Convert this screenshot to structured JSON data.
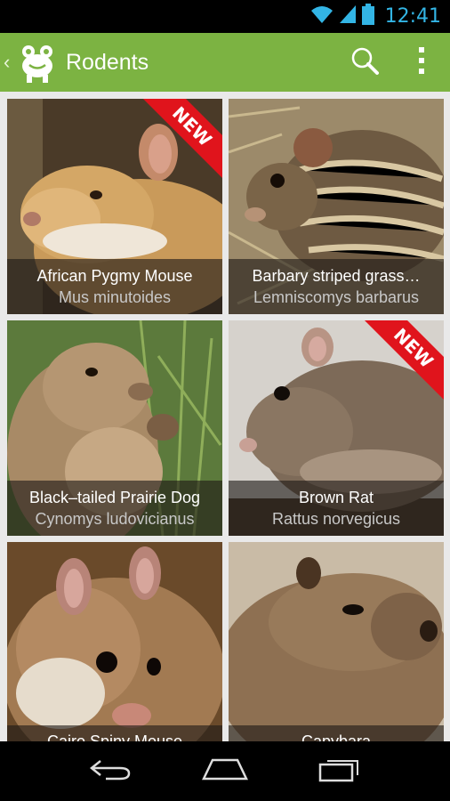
{
  "status_bar": {
    "time": "12:41",
    "icons": [
      "wifi-icon",
      "signal-icon",
      "battery-icon"
    ],
    "time_color": "#33b5e5"
  },
  "action_bar": {
    "title": "Rodents",
    "background": "#7cb342",
    "actions": [
      "search-icon",
      "overflow-menu-icon"
    ]
  },
  "grid": {
    "items": [
      {
        "common_name": "African Pygmy Mouse",
        "scientific_name": "Mus minutoides",
        "is_new": true,
        "badge": "NEW"
      },
      {
        "common_name": "Barbary striped grass…",
        "scientific_name": "Lemniscomys barbarus",
        "is_new": false,
        "badge": ""
      },
      {
        "common_name": "Black–tailed Prairie Dog",
        "scientific_name": "Cynomys ludovicianus",
        "is_new": false,
        "badge": ""
      },
      {
        "common_name": "Brown Rat",
        "scientific_name": "Rattus norvegicus",
        "is_new": true,
        "badge": "NEW"
      },
      {
        "common_name": "Cairo Spiny Mouse",
        "scientific_name": "",
        "is_new": false,
        "badge": ""
      },
      {
        "common_name": "Capybara",
        "scientific_name": "",
        "is_new": false,
        "badge": ""
      }
    ]
  },
  "nav_bar": {
    "buttons": [
      "back-icon",
      "home-icon",
      "recent-apps-icon"
    ]
  }
}
